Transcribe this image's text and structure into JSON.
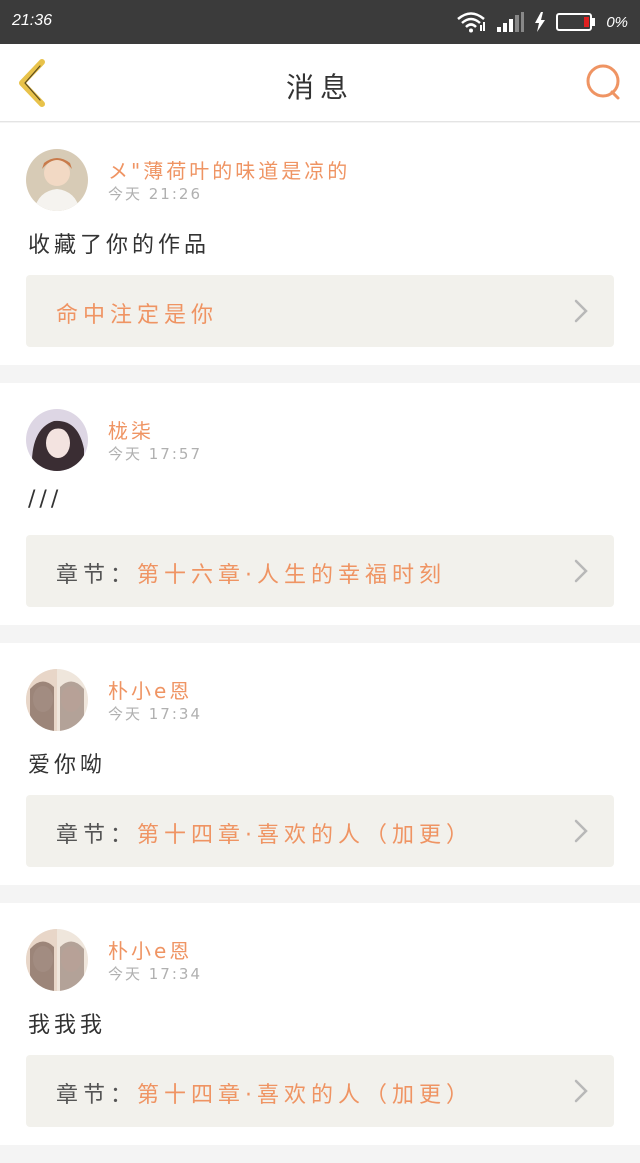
{
  "status_bar": {
    "time": "21:36",
    "battery_percent": "0%",
    "icons": [
      "wifi-icon",
      "signal-icon",
      "charging-bolt-icon",
      "battery-icon"
    ]
  },
  "header": {
    "title": "消息",
    "back_icon": "chevron-left-icon",
    "search_icon": "search-icon"
  },
  "colors": {
    "accent": "#ef9463",
    "back_icon": "#e8c24a",
    "background": "#f4f4f4",
    "ref_box": "#f2f1ec"
  },
  "messages": [
    {
      "username": "メ\"薄荷叶的味道是凉的",
      "time": "今天 21:26",
      "text": "收藏了你的作品",
      "ref_prefix": "",
      "ref_title": "命中注定是你"
    },
    {
      "username": "栊柒",
      "time": "今天 17:57",
      "text": "///",
      "ref_prefix": "章节：",
      "ref_title": "第十六章·人生的幸福时刻"
    },
    {
      "username": "朴小e恩",
      "time": "今天 17:34",
      "text": "爱你呦",
      "ref_prefix": "章节：",
      "ref_title": "第十四章·喜欢的人（加更）"
    },
    {
      "username": "朴小e恩",
      "time": "今天 17:34",
      "text": "我我我",
      "ref_prefix": "章节：",
      "ref_title": "第十四章·喜欢的人（加更）"
    }
  ]
}
